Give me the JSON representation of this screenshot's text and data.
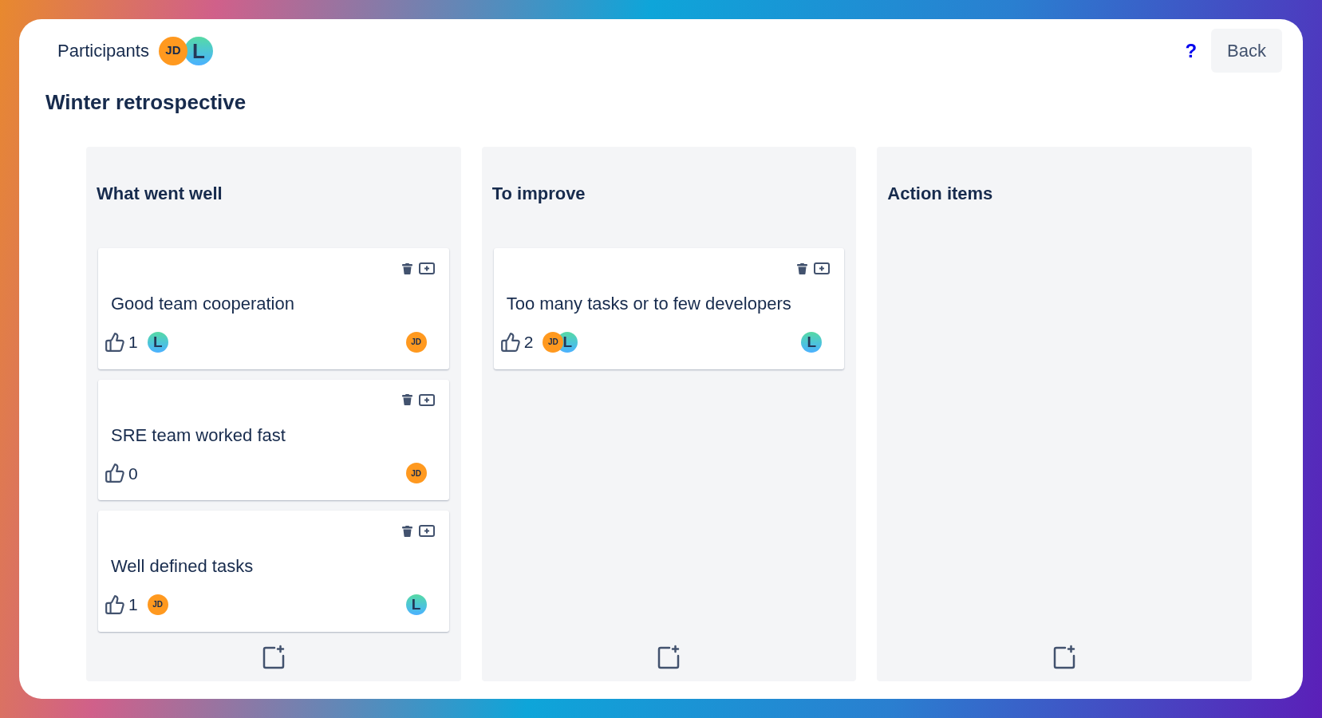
{
  "header": {
    "label": "Participants",
    "participants": [
      {
        "kind": "initials",
        "text": "JD"
      },
      {
        "kind": "gradient",
        "text": "L"
      }
    ],
    "help": "?",
    "back": "Back"
  },
  "title": "Winter retrospective",
  "columns": [
    {
      "title": "What went well",
      "cards": [
        {
          "text": "Good team cooperation",
          "votes": "1",
          "voters": [
            {
              "kind": "gradient",
              "text": "L"
            }
          ],
          "author": {
            "kind": "initials",
            "text": "JD"
          }
        },
        {
          "text": "SRE team worked fast",
          "votes": "0",
          "author": {
            "kind": "initials",
            "text": "JD"
          }
        },
        {
          "text": "Well defined tasks",
          "votes": "1",
          "voters": [
            {
              "kind": "initials",
              "text": "JD"
            }
          ],
          "author": {
            "kind": "gradient",
            "text": "L"
          }
        }
      ]
    },
    {
      "title": "To improve",
      "cards": [
        {
          "text": "Too many tasks or to few developers",
          "votes": "2",
          "voters": [
            {
              "kind": "initials",
              "text": "JD"
            },
            {
              "kind": "gradient",
              "text": "L"
            }
          ],
          "author": {
            "kind": "gradient",
            "text": "L"
          }
        }
      ]
    },
    {
      "title": "Action items"
    }
  ]
}
